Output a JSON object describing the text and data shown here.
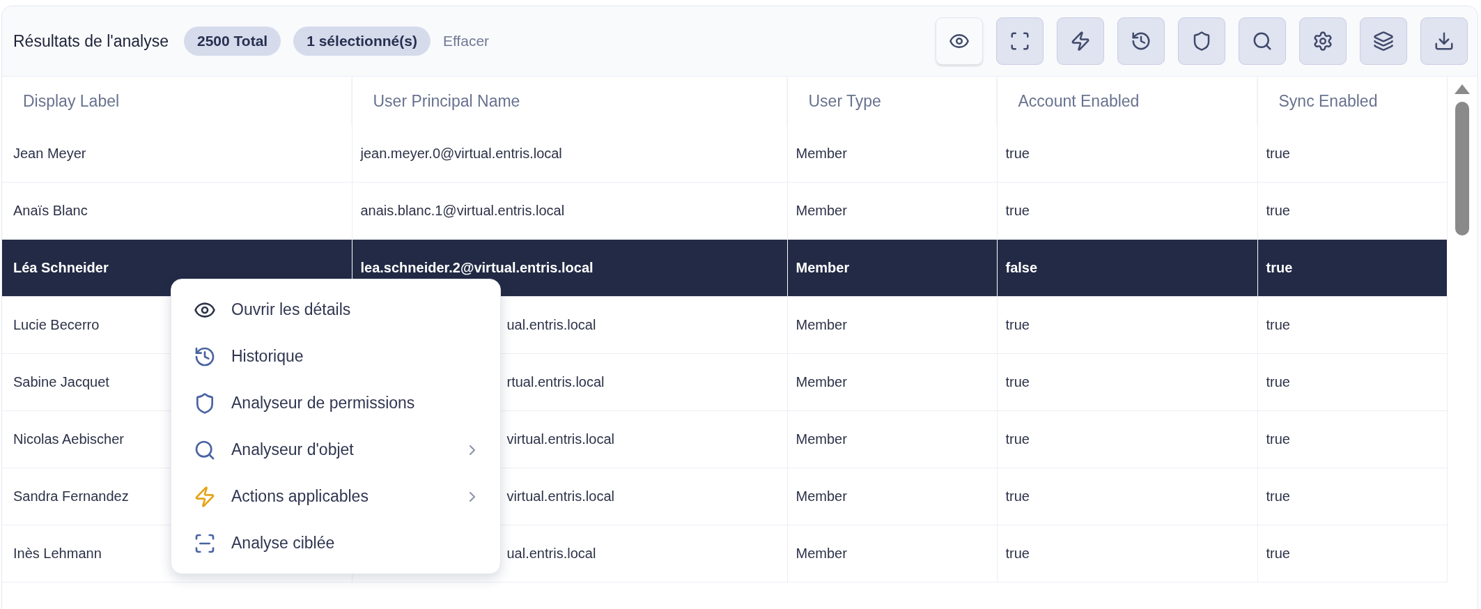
{
  "header": {
    "title": "Résultats de l'analyse",
    "total_badge": "2500 Total",
    "selected_badge": "1 sélectionné(s)",
    "clear_link": "Effacer"
  },
  "toolbar": [
    {
      "selected": true
    },
    {
      "selected": false
    },
    {
      "selected": false
    },
    {
      "selected": false
    },
    {
      "selected": false
    },
    {
      "selected": false
    },
    {
      "selected": false
    },
    {
      "selected": false
    },
    {
      "selected": false
    }
  ],
  "table": {
    "columns": [
      "Display Label",
      "User Principal Name",
      "User Type",
      "Account Enabled",
      "Sync Enabled"
    ],
    "rows": [
      {
        "selected": false,
        "cells": [
          "Jean Meyer",
          "jean.meyer.0@virtual.entris.local",
          "Member",
          "true",
          "true"
        ]
      },
      {
        "selected": false,
        "cells": [
          "Anaïs Blanc",
          "anais.blanc.1@virtual.entris.local",
          "Member",
          "true",
          "true"
        ]
      },
      {
        "selected": true,
        "cells": [
          "Léa Schneider",
          "lea.schneider.2@virtual.entris.local",
          "Member",
          "false",
          "true"
        ]
      },
      {
        "selected": false,
        "cells": [
          "Lucie Becerro",
          {
            "text": "ual.entris.local",
            "covered": true
          },
          "Member",
          "true",
          "true"
        ]
      },
      {
        "selected": false,
        "cells": [
          "Sabine Jacquet",
          {
            "text": "rtual.entris.local",
            "covered": true
          },
          "Member",
          "true",
          "true"
        ]
      },
      {
        "selected": false,
        "cells": [
          "Nicolas Aebischer",
          {
            "text": "virtual.entris.local",
            "covered": true
          },
          "Member",
          "true",
          "true"
        ]
      },
      {
        "selected": false,
        "cells": [
          "Sandra Fernandez",
          {
            "text": "virtual.entris.local",
            "covered": true
          },
          "Member",
          "true",
          "true"
        ]
      },
      {
        "selected": false,
        "cells": [
          "Inès Lehmann",
          {
            "text": "ual.entris.local",
            "covered": true
          },
          "Member",
          "true",
          "true"
        ]
      }
    ]
  },
  "context_menu": {
    "items": [
      {
        "label": "Ouvrir les détails",
        "submenu": false
      },
      {
        "label": "Historique",
        "submenu": false
      },
      {
        "label": "Analyseur de permissions",
        "submenu": false
      },
      {
        "label": "Analyseur d'objet",
        "submenu": true
      },
      {
        "label": "Actions applicables",
        "submenu": true
      },
      {
        "label": "Analyse ciblée",
        "submenu": false
      }
    ]
  }
}
